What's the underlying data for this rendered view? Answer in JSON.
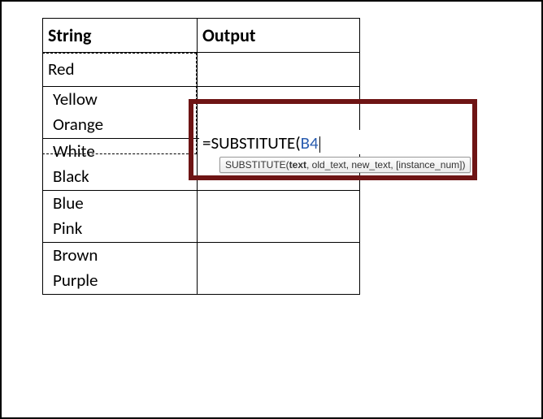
{
  "headers": {
    "string": "String",
    "output": "Output"
  },
  "groups": [
    {
      "lines": [
        "Red",
        "Yellow",
        "Orange"
      ]
    },
    {
      "lines": [
        "White",
        "Black"
      ]
    },
    {
      "lines": [
        "Blue",
        "Pink"
      ]
    },
    {
      "lines": [
        "Brown",
        "Purple"
      ]
    }
  ],
  "active_cell": {
    "prefix": "=SUBSTITUTE(",
    "reference": "B4"
  },
  "tooltip": {
    "fn": "SUBSTITUTE(",
    "arg_bold": "text",
    "rest": ", old_text, new_text, [instance_num])"
  }
}
